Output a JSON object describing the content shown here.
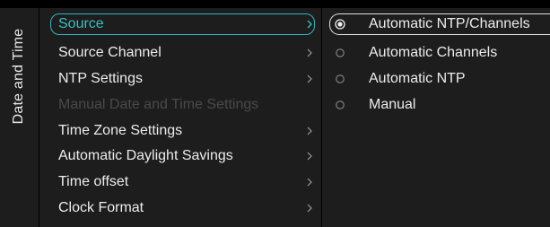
{
  "side": {
    "title": "Date and Time"
  },
  "menu": {
    "items": [
      {
        "label": "Source",
        "state": "focused",
        "has_submenu": true
      },
      {
        "label": "Source Channel",
        "state": "normal",
        "has_submenu": true
      },
      {
        "label": "NTP Settings",
        "state": "normal",
        "has_submenu": true
      },
      {
        "label": "Manual Date and Time Settings",
        "state": "disabled",
        "has_submenu": false
      },
      {
        "label": "Time Zone Settings",
        "state": "normal",
        "has_submenu": true
      },
      {
        "label": "Automatic Daylight Savings",
        "state": "normal",
        "has_submenu": true
      },
      {
        "label": "Time offset",
        "state": "normal",
        "has_submenu": true
      },
      {
        "label": "Clock Format",
        "state": "normal",
        "has_submenu": true
      }
    ]
  },
  "options": {
    "items": [
      {
        "label": "Automatic NTP/Channels",
        "selected": true
      },
      {
        "label": "Automatic Channels",
        "selected": false
      },
      {
        "label": "Automatic NTP",
        "selected": false
      },
      {
        "label": "Manual",
        "selected": false
      }
    ]
  },
  "colors": {
    "background": "#000000",
    "panel": "#1d1d1d",
    "text": "#ececec",
    "accent": "#2fb4b8",
    "disabled_text": "#4a4a4a"
  },
  "icons": {
    "submenu": "chevron-right-icon",
    "selected_radio": "radio-selected-icon",
    "unselected_radio": "radio-unselected-icon"
  }
}
